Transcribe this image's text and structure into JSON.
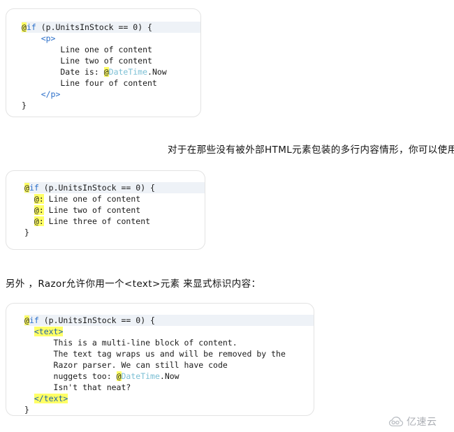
{
  "document": {
    "language": "zh-CN",
    "topic": "Razor multi-line content syntax"
  },
  "code_blocks": [
    {
      "id": "block1",
      "caption_role": "example-wrapped-in-p-tag",
      "lines": [
        {
          "segments": [
            {
              "text": "@",
              "style": "at-hl"
            },
            {
              "text": "if",
              "style": "kw"
            },
            {
              "text": " (p.UnitsInStock == 0) {",
              "style": "plain"
            }
          ],
          "line_highlight": true
        },
        {
          "segments": [
            {
              "text": "    <p>",
              "style": "kw"
            }
          ],
          "line_highlight": false
        },
        {
          "segments": [
            {
              "text": "        Line one of content",
              "style": "plain"
            }
          ],
          "line_highlight": false
        },
        {
          "segments": [
            {
              "text": "        Line two of content",
              "style": "plain"
            }
          ],
          "line_highlight": false
        },
        {
          "segments": [
            {
              "text": "        Date is: ",
              "style": "plain"
            },
            {
              "text": "@",
              "style": "at-hl"
            },
            {
              "text": "DateTime",
              "style": "type"
            },
            {
              "text": ".Now",
              "style": "plain"
            }
          ],
          "line_highlight": false
        },
        {
          "segments": [
            {
              "text": "        Line four of content",
              "style": "plain"
            }
          ],
          "line_highlight": false
        },
        {
          "segments": [
            {
              "text": "    </p>",
              "style": "kw"
            }
          ],
          "line_highlight": false
        },
        {
          "segments": [
            {
              "text": "}",
              "style": "plain"
            }
          ],
          "line_highlight": false
        }
      ]
    },
    {
      "id": "block2",
      "caption_role": "example-at-colon-sequences",
      "lines": [
        {
          "segments": [
            {
              "text": "@",
              "style": "at-hl"
            },
            {
              "text": "if",
              "style": "kw"
            },
            {
              "text": " (p.UnitsInStock == 0) {",
              "style": "plain"
            }
          ],
          "line_highlight": true
        },
        {
          "segments": [
            {
              "text": "  ",
              "style": "plain"
            },
            {
              "text": "@:",
              "style": "at-hl"
            },
            {
              "text": " Line one of content",
              "style": "plain"
            }
          ],
          "line_highlight": false
        },
        {
          "segments": [
            {
              "text": "  ",
              "style": "plain"
            },
            {
              "text": "@:",
              "style": "at-hl"
            },
            {
              "text": " Line two of content",
              "style": "plain"
            }
          ],
          "line_highlight": false
        },
        {
          "segments": [
            {
              "text": "  ",
              "style": "plain"
            },
            {
              "text": "@:",
              "style": "at-hl"
            },
            {
              "text": " Line three of content",
              "style": "plain"
            }
          ],
          "line_highlight": false
        },
        {
          "segments": [
            {
              "text": "}",
              "style": "plain"
            }
          ],
          "line_highlight": false
        }
      ]
    },
    {
      "id": "block3",
      "caption_role": "example-text-tag",
      "lines": [
        {
          "segments": [
            {
              "text": "@",
              "style": "at-hl"
            },
            {
              "text": "if",
              "style": "kw"
            },
            {
              "text": " (p.UnitsInStock == 0) {",
              "style": "plain"
            }
          ],
          "line_highlight": true
        },
        {
          "segments": [
            {
              "text": "  ",
              "style": "plain"
            },
            {
              "text": "<text>",
              "style": "tag-hl"
            }
          ],
          "line_highlight": false
        },
        {
          "segments": [
            {
              "text": "      This is a multi-line block of content.",
              "style": "plain"
            }
          ],
          "line_highlight": false
        },
        {
          "segments": [
            {
              "text": "      The text tag wraps us and will be removed by the",
              "style": "plain"
            }
          ],
          "line_highlight": false
        },
        {
          "segments": [
            {
              "text": "      Razor parser. We can still have code",
              "style": "plain"
            }
          ],
          "line_highlight": false
        },
        {
          "segments": [
            {
              "text": "      nuggets too: ",
              "style": "plain"
            },
            {
              "text": "@",
              "style": "at-hl"
            },
            {
              "text": "DateTime",
              "style": "type"
            },
            {
              "text": ".Now",
              "style": "plain"
            }
          ],
          "line_highlight": false
        },
        {
          "segments": [
            {
              "text": "      Isn't that neat?",
              "style": "plain"
            }
          ],
          "line_highlight": false
        },
        {
          "segments": [
            {
              "text": "  ",
              "style": "plain"
            },
            {
              "text": "</text>",
              "style": "tag-hl"
            }
          ],
          "line_highlight": false
        },
        {
          "segments": [
            {
              "text": "}",
              "style": "plain"
            }
          ],
          "line_highlight": false
        }
      ]
    }
  ],
  "paragraphs": {
    "para1": "对于在那些没有被外部HTML元素包装的多行内容情形，你可以使用多个@：序列：",
    "para2": "另外 ，Razor允许你用一个<text>元素 来显式标识内容："
  },
  "watermark": {
    "text": "亿速云",
    "icon": "cloud-icon",
    "color": "#8d9199"
  },
  "colors": {
    "at_highlight": "#ffff66",
    "keyword_blue": "#2b6fc9",
    "type_teal": "#7bbfd4",
    "line_highlight": "#eef2f7",
    "block_border": "#e3e3e3",
    "text": "#111111",
    "background": "#ffffff"
  }
}
